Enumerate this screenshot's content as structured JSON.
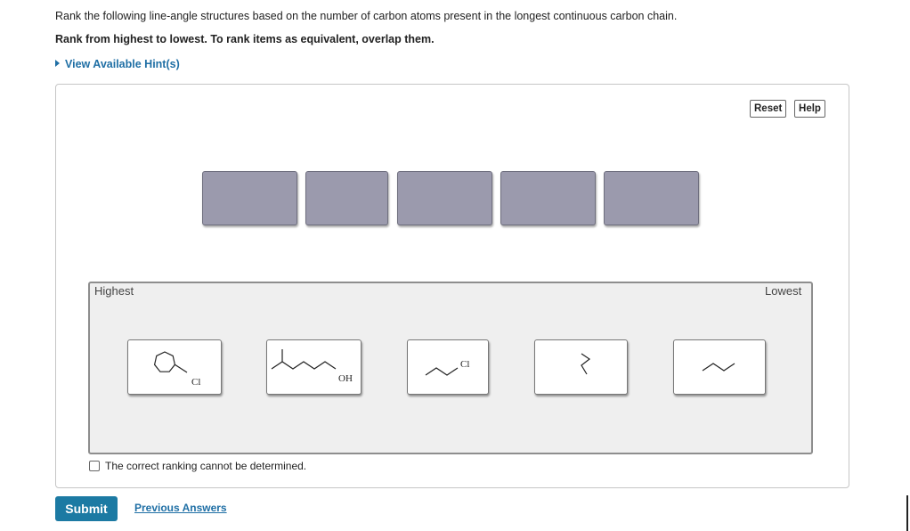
{
  "question": {
    "text": "Rank the following line-angle structures based on the number of carbon atoms present in the longest continuous carbon chain.",
    "instruction": "Rank from highest to lowest. To rank items as equivalent, overlap them.",
    "hint_link": "View Available Hint(s)"
  },
  "toolbar": {
    "reset_label": "Reset",
    "help_label": "Help"
  },
  "answer_slots": {
    "count": 5
  },
  "ranking": {
    "highest_label": "Highest",
    "lowest_label": "Lowest"
  },
  "items": [
    {
      "id": "cycloheptyl-chloride",
      "labels": [
        "Cl"
      ]
    },
    {
      "id": "branched-alcohol",
      "labels": [
        "OH"
      ]
    },
    {
      "id": "chloro-chain",
      "labels": [
        "Cl"
      ]
    },
    {
      "id": "zigzag-vertical",
      "labels": []
    },
    {
      "id": "short-chain",
      "labels": []
    }
  ],
  "checkbox": {
    "label": "The correct ranking cannot be determined.",
    "checked": false
  },
  "actions": {
    "submit_label": "Submit",
    "previous_answers_label": "Previous Answers"
  }
}
